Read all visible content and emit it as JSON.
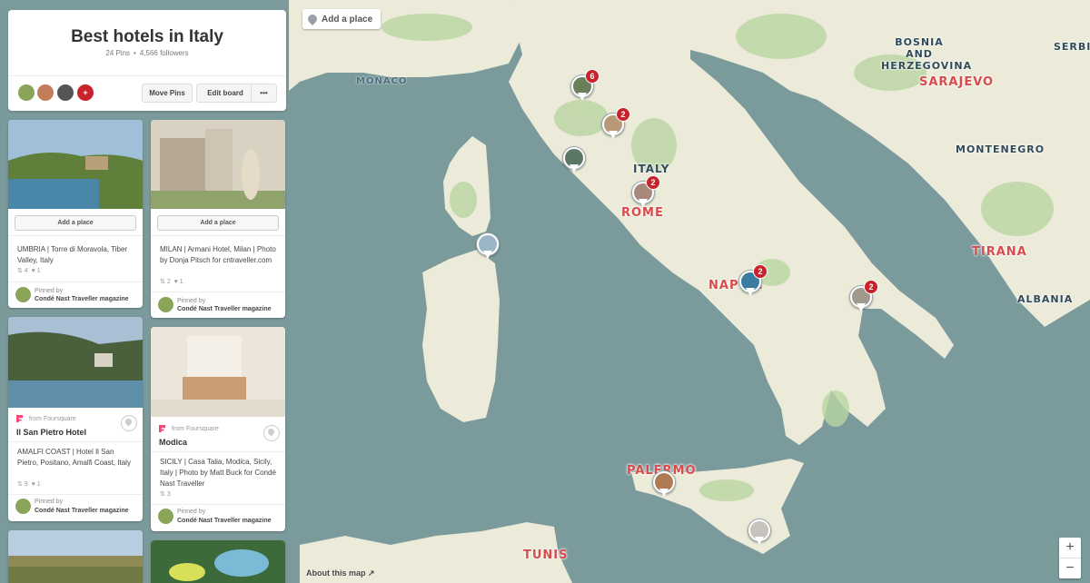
{
  "board": {
    "title": "Best hotels in Italy",
    "pins_count": "24 Pins",
    "followers": "4,566 followers",
    "avatar_add": "+",
    "move_pins": "Move Pins",
    "edit_board": "Edit board",
    "more": "•••"
  },
  "pins": [
    {
      "add_place": "Add a place",
      "description": "UMBRIA | Torre di Moravola, Tiber Valley, Italy",
      "repins": "4",
      "likes": "1",
      "pinned_by_label": "Pinned by",
      "pinner": "Condé Nast Traveller magazine"
    },
    {
      "add_place": "Add a place",
      "description": "MILAN | Armani Hotel, Milan | Photo by Donja Pitsch for cntraveller.com",
      "repins": "2",
      "likes": "1",
      "pinned_by_label": "Pinned by",
      "pinner": "Condé Nast Traveller magazine"
    },
    {
      "from_source": "from Foursquare",
      "place_name": "Il San Pietro Hotel",
      "description": "AMALFI COAST | Hotel Il San Pietro, Positano, Amalfi Coast, Italy",
      "repins": "9",
      "likes": "1",
      "pinned_by_label": "Pinned by",
      "pinner": "Condé Nast Traveller magazine"
    },
    {
      "from_source": "from Foursquare",
      "place_name": "Modica",
      "description": "SICILY | Casa Talia, Modica, Sicily, Italy | Photo by Matt Buck for Condé Nast Traveller",
      "repins": "3",
      "pinned_by_label": "Pinned by",
      "pinner": "Condé Nast Traveller magazine"
    }
  ],
  "map": {
    "add_place": "Add a place",
    "about": "About this map",
    "zoom_in": "+",
    "zoom_out": "−",
    "labels": {
      "monaco": "MONACO",
      "italy": "ITALY",
      "rome": "ROME",
      "napoli": "NAPOLI",
      "palermo": "PALERMO",
      "tunis": "TUNIS",
      "bosnia": "BOSNIA AND HERZEGOVINA",
      "sarajevo": "SARAJEVO",
      "serbia": "SERBIA",
      "montenegro": "MONTENEGRO",
      "tirana": "TIRANA",
      "albania": "ALBANIA"
    },
    "pin_counts": {
      "north": "6",
      "tuscany": "2",
      "rome": "2",
      "naples": "2",
      "puglia": "2"
    }
  },
  "colors": {
    "sea": "#7b9a9c",
    "land": "#ecead8",
    "accent_red": "#c8232c",
    "foursquare": "#f94877"
  }
}
